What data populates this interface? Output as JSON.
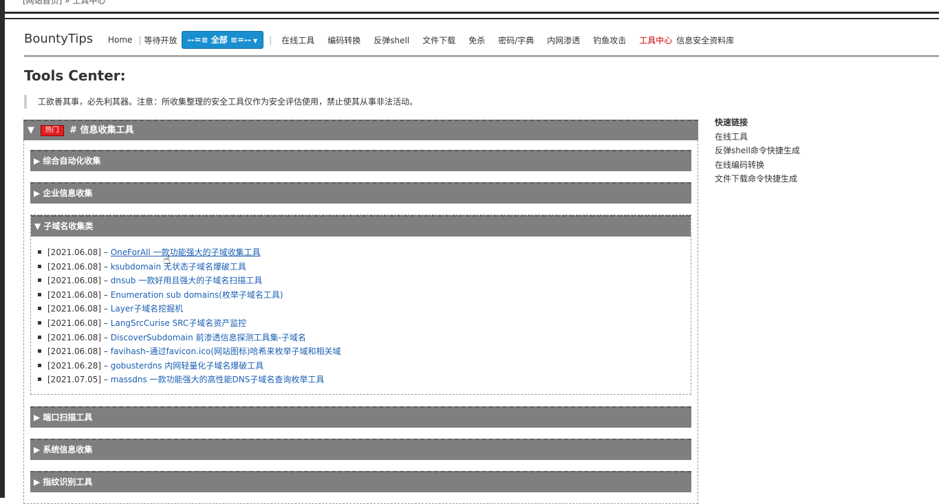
{
  "breadcrumb": "[网站首页] » 工具中心",
  "brand": "BountyTips",
  "nav": {
    "home": "Home",
    "pending": "等待开放",
    "dropdown": "--=≡ 全部 ≡=--",
    "links": [
      "在线工具",
      "编码转换",
      "反弹shell",
      "文件下载",
      "免杀",
      "密码/字典",
      "内网渗透",
      "钓鱼攻击"
    ],
    "active": "工具中心",
    "last": "信息安全资料库"
  },
  "page_title": "Tools Center:",
  "quote": "工欲善其事，必先利其器。注意：所收集整理的安全工具仅作为安全评估使用，禁止使其从事非法活动。",
  "category": {
    "arrow": "▼",
    "badge": "热门",
    "label": "# 信息收集工具",
    "subs_closed_top": [
      {
        "label": "▶ 综合自动化收集"
      },
      {
        "label": "▶ 企业信息收集"
      }
    ],
    "sub_open": {
      "label": "▼ 子域名收集类",
      "items": [
        {
          "date": "[2021.06.08] –",
          "title": "OneForAll 一款功能强大的子域收集工具"
        },
        {
          "date": "[2021.06.08] –",
          "title": "ksubdomain 无状态子域名爆破工具"
        },
        {
          "date": "[2021.06.08] –",
          "title": "dnsub 一款好用且强大的子域名扫描工具"
        },
        {
          "date": "[2021.06.08] –",
          "title": "Enumeration sub domains(枚举子域名工具)"
        },
        {
          "date": "[2021.06.08] –",
          "title": "Layer子域名挖掘机"
        },
        {
          "date": "[2021.06.08] –",
          "title": "LangSrcCurise SRC子域名资产监控"
        },
        {
          "date": "[2021.06.08] –",
          "title": "DiscoverSubdomain 前渗透信息探测工具集-子域名"
        },
        {
          "date": "[2021.06.08] –",
          "title": "favihash–通过favicon.ico(网站图标)哈希来枚举子域和相关域"
        },
        {
          "date": "[2021.06.28] –",
          "title": "gobusterdns 内网轻量化子域名爆破工具"
        },
        {
          "date": "[2021.07.05] –",
          "title": "massdns 一款功能强大的高性能DNS子域名查询枚举工具"
        }
      ]
    },
    "subs_closed_bottom": [
      {
        "label": "▶ 端口扫描工具"
      },
      {
        "label": "▶ 系统信息收集"
      },
      {
        "label": "▶ 指纹识别工具"
      }
    ]
  },
  "quick_links": {
    "title": "快速链接",
    "items": [
      "在线工具",
      "反弹shell命令快捷生成",
      "在线编码转换",
      "文件下载命令快捷生成"
    ]
  }
}
